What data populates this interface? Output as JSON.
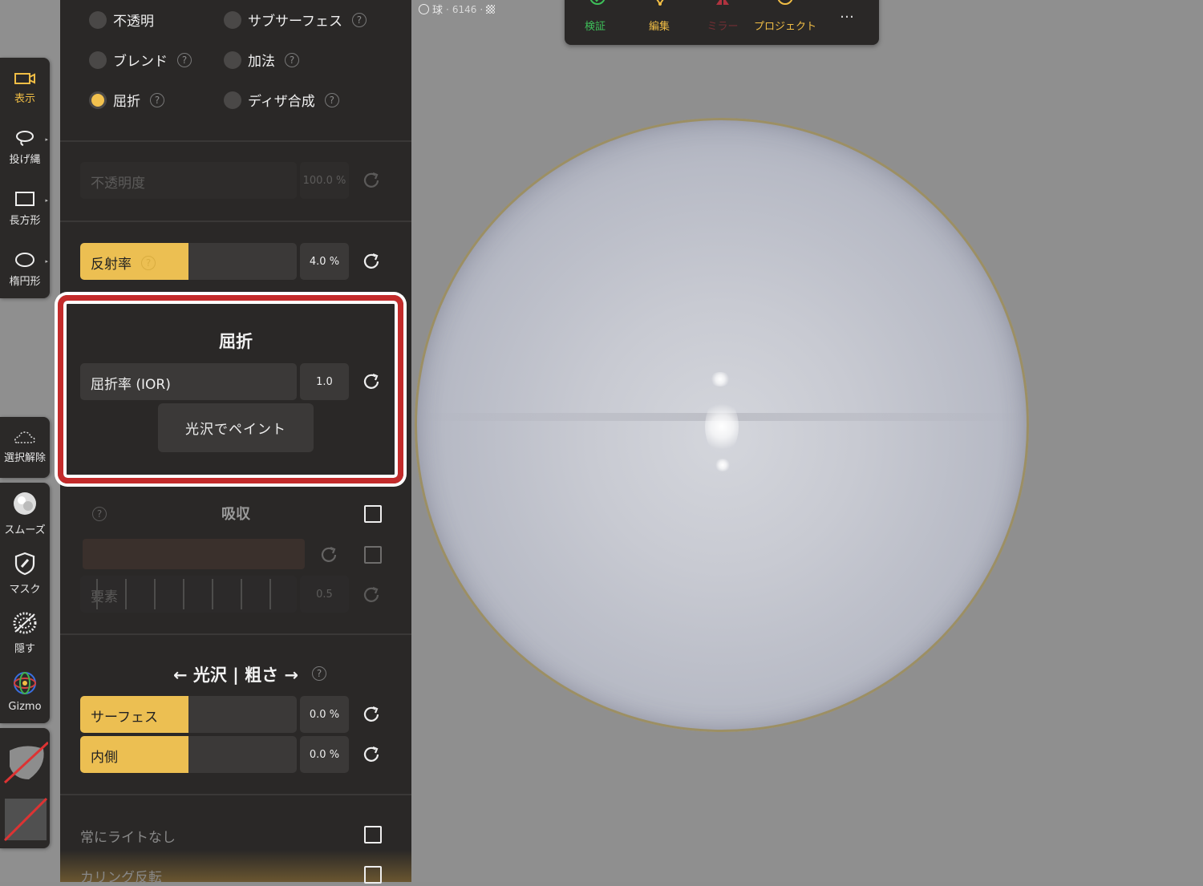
{
  "viewport": {
    "object_info": {
      "name": "球",
      "count": "6146"
    }
  },
  "topbar": {
    "items": [
      {
        "label": "検証",
        "icon": "check-circle-icon",
        "color": "#3ec15a"
      },
      {
        "label": "編集",
        "icon": "vertex-icon",
        "color": "#f0bd45"
      },
      {
        "label": "ミラー",
        "icon": "mirror-icon",
        "color": "#b0333f"
      },
      {
        "label": "プロジェクト",
        "icon": "circle-icon",
        "color": "#f0bd45"
      }
    ],
    "more": "…"
  },
  "left_toolbar": {
    "items": [
      {
        "label": "表示",
        "icon": "camera-icon",
        "active": true
      },
      {
        "label": "投げ縄",
        "icon": "lasso-icon"
      },
      {
        "label": "長方形",
        "icon": "rectangle-icon"
      },
      {
        "label": "楕円形",
        "icon": "ellipse-icon"
      }
    ],
    "deselect": "選択解除",
    "tools": [
      {
        "label": "スムーズ",
        "icon": "smooth-icon"
      },
      {
        "label": "マスク",
        "icon": "mask-icon"
      },
      {
        "label": "隠す",
        "icon": "hide-icon"
      },
      {
        "label": "Gizmo",
        "icon": "gizmo-icon"
      }
    ]
  },
  "panel": {
    "blend_modes": [
      {
        "label": "不透明",
        "selected": false,
        "help": false
      },
      {
        "label": "サブサーフェス",
        "selected": false,
        "help": true
      },
      {
        "label": "ブレンド",
        "selected": false,
        "help": true
      },
      {
        "label": "加法",
        "selected": false,
        "help": true
      },
      {
        "label": "屈折",
        "selected": true,
        "help": true
      },
      {
        "label": "ディザ合成",
        "selected": false,
        "help": true
      }
    ],
    "opacity": {
      "label": "不透明度",
      "value": "100.0 %"
    },
    "reflectance": {
      "label": "反射率",
      "value": "4.0 %",
      "fill": 0.5
    },
    "refraction": {
      "title": "屈折",
      "ior_label": "屈折率 (IOR)",
      "ior_value": "1.0",
      "paint_button": "光沢でペイント"
    },
    "absorption": {
      "title": "吸収",
      "element_label": "要素",
      "element_value": "0.5"
    },
    "gloss_rough": {
      "title": "← 光沢 | 粗さ →",
      "surface": {
        "label": "サーフェス",
        "value": "0.0 %",
        "fill": 0.5
      },
      "inner": {
        "label": "内側",
        "value": "0.0 %",
        "fill": 0.5
      }
    },
    "always_unlit": "常にライトなし",
    "flip_culling": "カリング反転"
  },
  "colors": {
    "accent": "#f2c14e",
    "panel": "#2a2827",
    "highlight": "#c32b2b"
  }
}
